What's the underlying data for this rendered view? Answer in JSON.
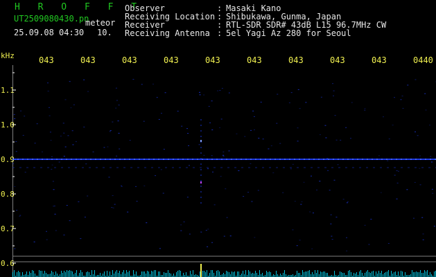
{
  "header": {
    "app_title": "H R O F F T",
    "filename": "UT2509080430.pn",
    "category": "meteor",
    "datetime": "25.09.08 04:30",
    "count": "10.",
    "labels": [
      "Observer",
      "Receiving Location",
      "Receiver",
      "Receiving Antenna"
    ],
    "separators": [
      ":",
      ":",
      ":",
      ":"
    ],
    "values": [
      "Masaki Kano",
      "Shibukawa, Gunma, Japan",
      "RTL-SDR SDR# 43dB L15 96.7MHz CW",
      "5el Yagi Az 280 for Seoul"
    ]
  },
  "spectrogram": {
    "y_unit": "kHz",
    "y_ticks": [
      "1.1",
      "1.0",
      "0.9",
      "0.8",
      "0.7",
      "0.6"
    ],
    "x_ticks": [
      "043",
      "043",
      "043",
      "043",
      "043",
      "043",
      "043",
      "043",
      "043",
      "0440"
    ],
    "colors": {
      "background": "#000000",
      "signal": "#2040ff",
      "signal_bright": "#80a0ff",
      "tick_marks": "#ffffff",
      "baseline": "#808080",
      "level": "#00e0ff"
    }
  }
}
